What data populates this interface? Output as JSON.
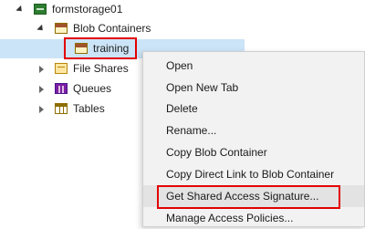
{
  "tree": {
    "account": "formstorage01",
    "blob_containers": "Blob Containers",
    "training": "training",
    "file_shares": "File Shares",
    "queues": "Queues",
    "tables": "Tables"
  },
  "context_menu": {
    "items": [
      "Open",
      "Open New Tab",
      "Delete",
      "Rename...",
      "Copy Blob Container",
      "Copy Direct Link to Blob Container",
      "Get Shared Access Signature...",
      "Manage Access Policies..."
    ],
    "highlighted_item": "Get Shared Access Signature..."
  },
  "colors": {
    "selection": "#cce4f7",
    "highlight_box": "#e30000",
    "menu_background": "#f2f2f2"
  }
}
